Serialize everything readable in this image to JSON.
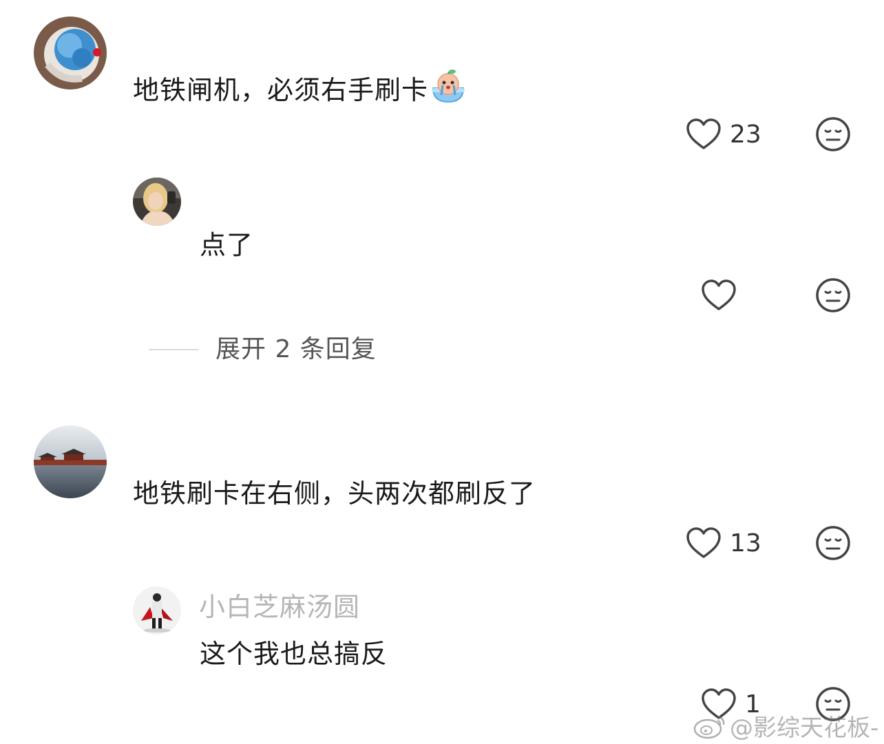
{
  "colors": {
    "text": "#1a1a1a",
    "username": "#b5b5b5",
    "icon": "#444444",
    "expand": "#555555"
  },
  "comments": [
    {
      "text": "地铁闸机，必须右手刷卡",
      "emoji": "crying-peach-emoji",
      "likes": "23",
      "replies": [
        {
          "username": "",
          "text": "点了",
          "likes": ""
        }
      ],
      "expand_label": "展开 2 条回复"
    },
    {
      "text": "地铁刷卡在右侧，头两次都刷反了",
      "likes": "13",
      "replies": [
        {
          "username": "小白芝麻汤圆",
          "text": "这个我也总搞反",
          "likes": "1"
        }
      ]
    }
  ],
  "icons": {
    "like": "heart-outline-icon",
    "dislike": "neutral-face-icon"
  },
  "watermark": {
    "text": "@影综天花板-",
    "logo": "weibo-logo"
  }
}
